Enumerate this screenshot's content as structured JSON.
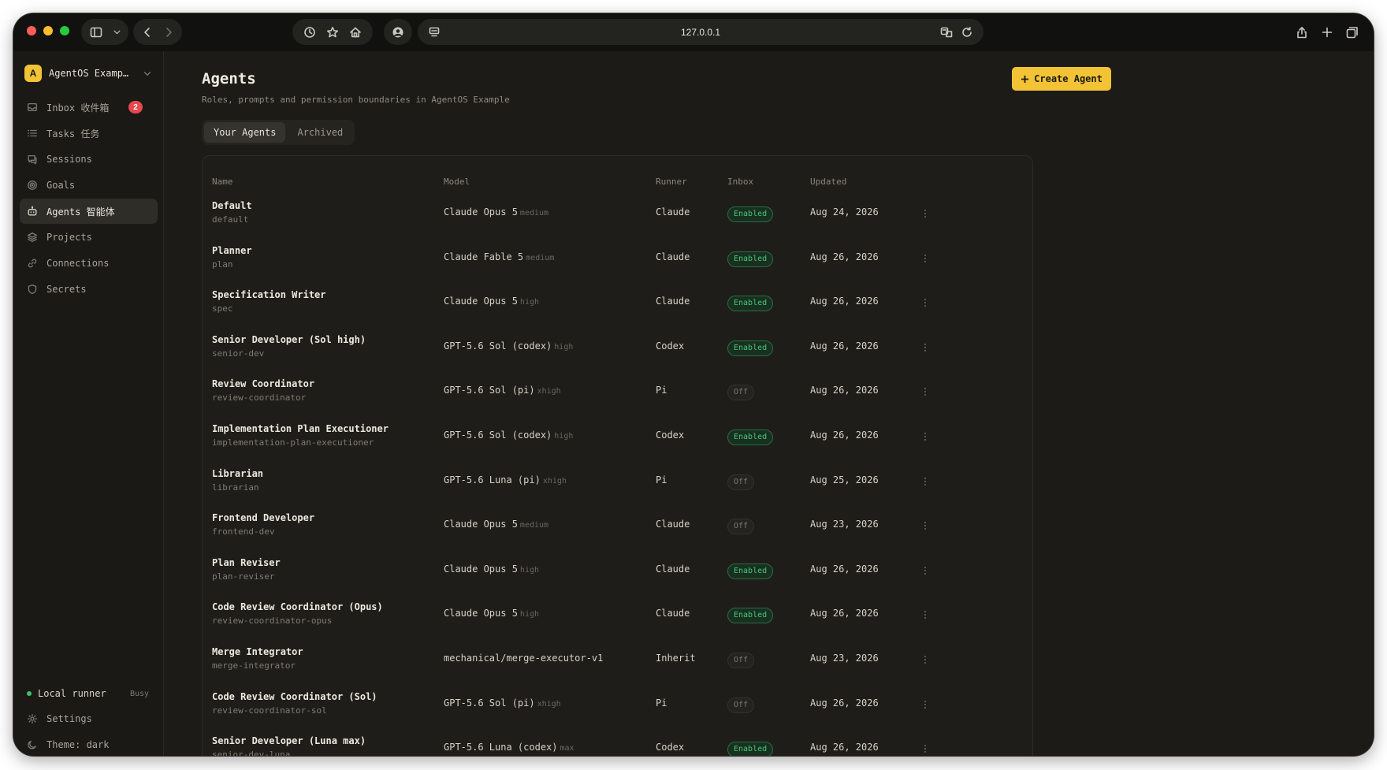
{
  "browser": {
    "url": "127.0.0.1"
  },
  "sidebar": {
    "workspace": {
      "initial": "A",
      "name": "AgentOS Examp…"
    },
    "items": [
      {
        "label": "Inbox  收件箱",
        "icon": "inbox-icon",
        "badge": "2",
        "active": false
      },
      {
        "label": "Tasks  任务",
        "icon": "list-icon",
        "active": false
      },
      {
        "label": "Sessions",
        "icon": "chat-icon",
        "active": false
      },
      {
        "label": "Goals",
        "icon": "target-icon",
        "active": false
      },
      {
        "label": "Agents  智能体",
        "icon": "bot-icon",
        "active": true
      },
      {
        "label": "Projects",
        "icon": "layers-icon",
        "active": false
      },
      {
        "label": "Connections",
        "icon": "link-icon",
        "active": false
      },
      {
        "label": "Secrets",
        "icon": "shield-icon",
        "active": false
      }
    ],
    "runner": {
      "label": "Local runner",
      "status": "Busy"
    },
    "settings_label": "Settings",
    "theme_label": "Theme: dark"
  },
  "main": {
    "title": "Agents",
    "subtitle": "Roles, prompts and permission boundaries in AgentOS Example",
    "create_label": "Create Agent",
    "tabs": [
      {
        "label": "Your Agents",
        "active": true
      },
      {
        "label": "Archived",
        "active": false
      }
    ],
    "columns": {
      "name": "Name",
      "model": "Model",
      "runner": "Runner",
      "inbox": "Inbox",
      "updated": "Updated"
    },
    "rows": [
      {
        "name": "Default",
        "slug": "default",
        "model": "Claude Opus 5",
        "effort": "medium",
        "runner": "Claude",
        "inbox": "Enabled",
        "updated": "Aug 24, 2026"
      },
      {
        "name": "Planner",
        "slug": "plan",
        "model": "Claude Fable 5",
        "effort": "medium",
        "runner": "Claude",
        "inbox": "Enabled",
        "updated": "Aug 26, 2026"
      },
      {
        "name": "Specification Writer",
        "slug": "spec",
        "model": "Claude Opus 5",
        "effort": "high",
        "runner": "Claude",
        "inbox": "Enabled",
        "updated": "Aug 26, 2026"
      },
      {
        "name": "Senior Developer (Sol high)",
        "slug": "senior-dev",
        "model": "GPT-5.6 Sol (codex)",
        "effort": "high",
        "runner": "Codex",
        "inbox": "Enabled",
        "updated": "Aug 26, 2026"
      },
      {
        "name": "Review Coordinator",
        "slug": "review-coordinator",
        "model": "GPT-5.6 Sol (pi)",
        "effort": "xhigh",
        "runner": "Pi",
        "inbox": "Off",
        "updated": "Aug 26, 2026"
      },
      {
        "name": "Implementation Plan Executioner",
        "slug": "implementation-plan-executioner",
        "model": "GPT-5.6 Sol (codex)",
        "effort": "high",
        "runner": "Codex",
        "inbox": "Enabled",
        "updated": "Aug 26, 2026"
      },
      {
        "name": "Librarian",
        "slug": "librarian",
        "model": "GPT-5.6 Luna (pi)",
        "effort": "xhigh",
        "runner": "Pi",
        "inbox": "Off",
        "updated": "Aug 25, 2026"
      },
      {
        "name": "Frontend Developer",
        "slug": "frontend-dev",
        "model": "Claude Opus 5",
        "effort": "medium",
        "runner": "Claude",
        "inbox": "Off",
        "updated": "Aug 23, 2026"
      },
      {
        "name": "Plan Reviser",
        "slug": "plan-reviser",
        "model": "Claude Opus 5",
        "effort": "high",
        "runner": "Claude",
        "inbox": "Enabled",
        "updated": "Aug 26, 2026"
      },
      {
        "name": "Code Review Coordinator (Opus)",
        "slug": "review-coordinator-opus",
        "model": "Claude Opus 5",
        "effort": "high",
        "runner": "Claude",
        "inbox": "Enabled",
        "updated": "Aug 26, 2026"
      },
      {
        "name": "Merge Integrator",
        "slug": "merge-integrator",
        "model": "mechanical/merge-executor-v1",
        "effort": "",
        "runner": "Inherit",
        "inbox": "Off",
        "updated": "Aug 23, 2026"
      },
      {
        "name": "Code Review Coordinator (Sol)",
        "slug": "review-coordinator-sol",
        "model": "GPT-5.6 Sol (pi)",
        "effort": "xhigh",
        "runner": "Pi",
        "inbox": "Off",
        "updated": "Aug 26, 2026"
      },
      {
        "name": "Senior Developer (Luna max)",
        "slug": "senior-dev-luna",
        "model": "GPT-5.6 Luna (codex)",
        "effort": "max",
        "runner": "Codex",
        "inbox": "Enabled",
        "updated": "Aug 26, 2026"
      }
    ]
  },
  "colors": {
    "accent": "#f2c335",
    "badge": "#e5484d",
    "enabled": "#4bc47c",
    "runner_online": "#3fbf6b"
  }
}
